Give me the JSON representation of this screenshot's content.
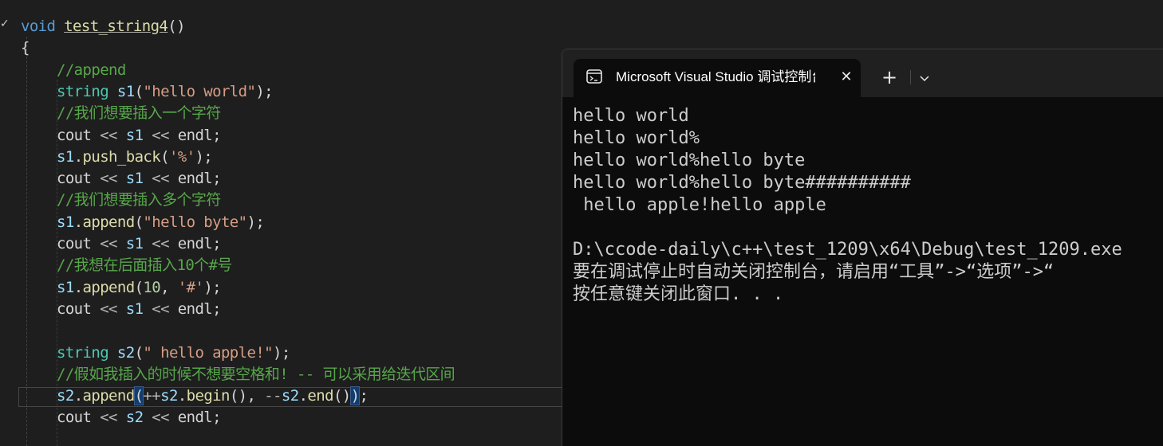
{
  "editor": {
    "lines": [
      {
        "indent": false,
        "tokens": [
          {
            "c": "kw",
            "t": "void"
          },
          {
            "c": "pl",
            "t": " "
          },
          {
            "c": "fn-u",
            "t": "test_string4"
          },
          {
            "c": "pl",
            "t": "()"
          }
        ]
      },
      {
        "indent": false,
        "tokens": [
          {
            "c": "pl",
            "t": "{"
          }
        ]
      },
      {
        "indent": true,
        "tokens": [
          {
            "c": "cmt",
            "t": "//append"
          }
        ]
      },
      {
        "indent": true,
        "tokens": [
          {
            "c": "typ",
            "t": "string"
          },
          {
            "c": "pl",
            "t": " "
          },
          {
            "c": "var",
            "t": "s1"
          },
          {
            "c": "pl",
            "t": "("
          },
          {
            "c": "str",
            "t": "\"hello world\""
          },
          {
            "c": "pl",
            "t": ");"
          }
        ]
      },
      {
        "indent": true,
        "tokens": [
          {
            "c": "cmt",
            "t": "//我们想要插入一个字符"
          }
        ]
      },
      {
        "indent": true,
        "tokens": [
          {
            "c": "pl",
            "t": "cout "
          },
          {
            "c": "op",
            "t": "<<"
          },
          {
            "c": "pl",
            "t": " "
          },
          {
            "c": "var",
            "t": "s1"
          },
          {
            "c": "pl",
            "t": " "
          },
          {
            "c": "op",
            "t": "<<"
          },
          {
            "c": "pl",
            "t": " endl;"
          }
        ]
      },
      {
        "indent": true,
        "tokens": [
          {
            "c": "var",
            "t": "s1"
          },
          {
            "c": "pl",
            "t": "."
          },
          {
            "c": "fn",
            "t": "push_back"
          },
          {
            "c": "pl",
            "t": "("
          },
          {
            "c": "str",
            "t": "'%'"
          },
          {
            "c": "pl",
            "t": ");"
          }
        ]
      },
      {
        "indent": true,
        "tokens": [
          {
            "c": "pl",
            "t": "cout "
          },
          {
            "c": "op",
            "t": "<<"
          },
          {
            "c": "pl",
            "t": " "
          },
          {
            "c": "var",
            "t": "s1"
          },
          {
            "c": "pl",
            "t": " "
          },
          {
            "c": "op",
            "t": "<<"
          },
          {
            "c": "pl",
            "t": " endl;"
          }
        ]
      },
      {
        "indent": true,
        "tokens": [
          {
            "c": "cmt",
            "t": "//我们想要插入多个字符"
          }
        ]
      },
      {
        "indent": true,
        "tokens": [
          {
            "c": "var",
            "t": "s1"
          },
          {
            "c": "pl",
            "t": "."
          },
          {
            "c": "fn",
            "t": "append"
          },
          {
            "c": "pl",
            "t": "("
          },
          {
            "c": "str",
            "t": "\"hello byte\""
          },
          {
            "c": "pl",
            "t": ");"
          }
        ]
      },
      {
        "indent": true,
        "tokens": [
          {
            "c": "pl",
            "t": "cout "
          },
          {
            "c": "op",
            "t": "<<"
          },
          {
            "c": "pl",
            "t": " "
          },
          {
            "c": "var",
            "t": "s1"
          },
          {
            "c": "pl",
            "t": " "
          },
          {
            "c": "op",
            "t": "<<"
          },
          {
            "c": "pl",
            "t": " endl;"
          }
        ]
      },
      {
        "indent": true,
        "tokens": [
          {
            "c": "cmt",
            "t": "//我想在后面插入10个#号"
          }
        ]
      },
      {
        "indent": true,
        "tokens": [
          {
            "c": "var",
            "t": "s1"
          },
          {
            "c": "pl",
            "t": "."
          },
          {
            "c": "fn",
            "t": "append"
          },
          {
            "c": "pl",
            "t": "("
          },
          {
            "c": "num",
            "t": "10"
          },
          {
            "c": "pl",
            "t": ", "
          },
          {
            "c": "str",
            "t": "'#'"
          },
          {
            "c": "pl",
            "t": ");"
          }
        ]
      },
      {
        "indent": true,
        "tokens": [
          {
            "c": "pl",
            "t": "cout "
          },
          {
            "c": "op",
            "t": "<<"
          },
          {
            "c": "pl",
            "t": " "
          },
          {
            "c": "var",
            "t": "s1"
          },
          {
            "c": "pl",
            "t": " "
          },
          {
            "c": "op",
            "t": "<<"
          },
          {
            "c": "pl",
            "t": " endl;"
          }
        ]
      },
      {
        "indent": true,
        "tokens": []
      },
      {
        "indent": true,
        "tokens": [
          {
            "c": "typ",
            "t": "string"
          },
          {
            "c": "pl",
            "t": " "
          },
          {
            "c": "var",
            "t": "s2"
          },
          {
            "c": "pl",
            "t": "("
          },
          {
            "c": "str",
            "t": "\" hello apple!\""
          },
          {
            "c": "pl",
            "t": ");"
          }
        ]
      },
      {
        "indent": true,
        "tokens": [
          {
            "c": "cmt",
            "t": "//假如我插入的时候不想要空格和! -- 可以采用给迭代区间"
          }
        ]
      },
      {
        "indent": true,
        "tokens": [
          {
            "c": "var",
            "t": "s2"
          },
          {
            "c": "pl",
            "t": "."
          },
          {
            "c": "fn",
            "t": "append"
          },
          {
            "c": "brk",
            "t": "("
          },
          {
            "c": "op",
            "t": "++"
          },
          {
            "c": "var",
            "t": "s2"
          },
          {
            "c": "pl",
            "t": "."
          },
          {
            "c": "fn",
            "t": "begin"
          },
          {
            "c": "pl",
            "t": "(), "
          },
          {
            "c": "op",
            "t": "--"
          },
          {
            "c": "var",
            "t": "s2"
          },
          {
            "c": "pl",
            "t": "."
          },
          {
            "c": "fn",
            "t": "end"
          },
          {
            "c": "pl",
            "t": "()"
          },
          {
            "c": "brk",
            "t": ")"
          },
          {
            "c": "pl",
            "t": ";"
          }
        ]
      },
      {
        "indent": true,
        "tokens": [
          {
            "c": "pl",
            "t": "cout "
          },
          {
            "c": "op",
            "t": "<<"
          },
          {
            "c": "pl",
            "t": " "
          },
          {
            "c": "var",
            "t": "s2"
          },
          {
            "c": "pl",
            "t": " "
          },
          {
            "c": "op",
            "t": "<<"
          },
          {
            "c": "pl",
            "t": " endl;"
          }
        ]
      }
    ]
  },
  "terminal": {
    "tab_title": "Microsoft Visual Studio 调试控制台",
    "tab_icon": "console-icon",
    "close_icon": "close-icon",
    "new_tab_label": "+",
    "dropdown_icon": "chevron-down-icon",
    "output": [
      "hello world",
      "hello world%",
      "hello world%hello byte",
      "hello world%hello byte##########",
      " hello apple!hello apple",
      "",
      "D:\\ccode-daily\\c++\\test_1209\\x64\\Debug\\test_1209.exe",
      "要在调试停止时自动关闭控制台，请启用“工具”->“选项”->“",
      "按任意键关闭此窗口. . ."
    ]
  },
  "colors": {
    "editor_bg": "#1e1e1e",
    "terminal_bg": "#0c0c0c",
    "titlebar_bg": "#202020"
  }
}
